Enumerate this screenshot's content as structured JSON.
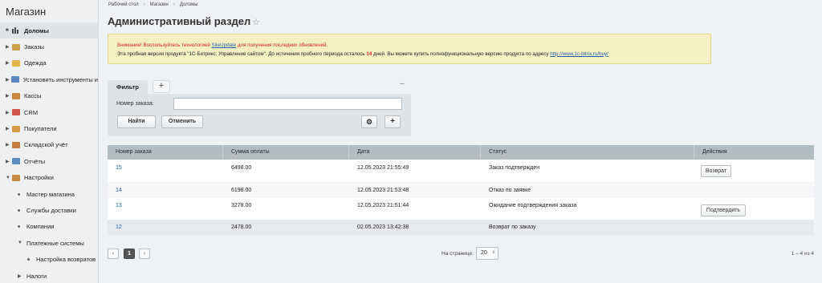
{
  "sidebar": {
    "title": "Магазин",
    "items": [
      {
        "label": "Доломы",
        "icon": "chart-icon",
        "color": "#444444"
      },
      {
        "label": "Заказы",
        "icon": "cart-icon",
        "color": "#c9a24a"
      },
      {
        "label": "Одежда",
        "icon": "folder-icon",
        "color": "#e2b74a"
      },
      {
        "label": "Установить инструменты и",
        "icon": "folder-icon",
        "color": "#5b86c2"
      },
      {
        "label": "Кассы",
        "icon": "cash-register-icon",
        "color": "#c98a3f"
      },
      {
        "label": "CRM",
        "icon": "crm-icon",
        "color": "#d2554d"
      },
      {
        "label": "Покупатели",
        "icon": "users-icon",
        "color": "#d59d46"
      },
      {
        "label": "Складской учёт",
        "icon": "warehouse-icon",
        "color": "#c57d3d"
      },
      {
        "label": "Отчёты",
        "icon": "report-icon",
        "color": "#5d8fc2"
      },
      {
        "label": "Настройки",
        "icon": "settings-icon",
        "color": "#c78a45"
      }
    ],
    "sub_items": [
      {
        "label": "Мастер магазина"
      },
      {
        "label": "Службы доставки"
      },
      {
        "label": "Компании"
      },
      {
        "label": "Платежные системы"
      },
      {
        "label": "Настройка возвратов"
      },
      {
        "label": "Налоги"
      }
    ]
  },
  "breadcrumb": [
    "Рабочий стол",
    "Магазин",
    "Доломы"
  ],
  "page_title": "Административный раздел",
  "notice": {
    "warning_prefix": "Внимание! Воспользуйтесь технологией ",
    "siteupdate": "SiteUpdate",
    "warning_suffix": " для получения последних обновлений.",
    "trial_text": "Эта пробная версия продукта \"1С-Битрикс: Управление сайтом\". До истечения пробного периода осталось ",
    "days": "14",
    "trial_suffix": " дней. Вы можете купить полнофункциональную версию продукта по адресу ",
    "url": "http://www.1c-bitrix.ru/buy/"
  },
  "filter": {
    "tab_label": "Фильтр",
    "add_tab": "+",
    "minimize": "–",
    "field_label": "Номер заказа:",
    "field_value": "",
    "find_button": "Найти",
    "cancel_button": "Отменить",
    "settings": "⚙",
    "add": "+"
  },
  "table": {
    "columns": [
      "Номер заказа",
      "Сумма оплаты",
      "Дата",
      "Статус",
      "Действия"
    ],
    "rows": [
      {
        "id": "15",
        "sum": "6498.00",
        "date": "12.05.2023 21:55:49",
        "status": "Заказ подтвержден",
        "action": "Возврат"
      },
      {
        "id": "14",
        "sum": "6198.00",
        "date": "12.05.2023 21:53:48",
        "status": "Отказ по заявке",
        "action": ""
      },
      {
        "id": "13",
        "sum": "3278.00",
        "date": "12.05.2023 21:51:44",
        "status": "Ожидание подтверждения заказа",
        "action": "Подтвердить"
      },
      {
        "id": "12",
        "sum": "2478.00",
        "date": "02.05.2023 13:42:38",
        "status": "Возврат по заказу",
        "action": ""
      }
    ]
  },
  "pager": {
    "prev": "‹",
    "current": "1",
    "next": "›",
    "per_page_label": "На странице:",
    "per_page": "20",
    "count": "1 – 4 из 4"
  }
}
